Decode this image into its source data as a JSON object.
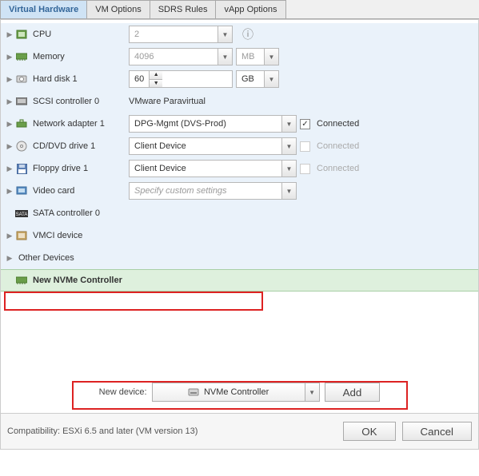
{
  "tabs": {
    "virtual_hardware": "Virtual Hardware",
    "vm_options": "VM Options",
    "sdrs_rules": "SDRS Rules",
    "vapp_options": "vApp Options"
  },
  "rows": {
    "cpu": {
      "label": "CPU",
      "value": "2"
    },
    "memory": {
      "label": "Memory",
      "value": "4096",
      "unit": "MB"
    },
    "hard_disk_1": {
      "label": "Hard disk 1",
      "value": "60",
      "unit": "GB"
    },
    "scsi_0": {
      "label": "SCSI controller 0",
      "value": "VMware Paravirtual"
    },
    "net_1": {
      "label": "Network adapter 1",
      "value": "DPG-Mgmt (DVS-Prod)",
      "connected_label": "Connected"
    },
    "cd_dvd_1": {
      "label": "CD/DVD drive 1",
      "value": "Client Device",
      "connected_label": "Connected"
    },
    "floppy_1": {
      "label": "Floppy drive 1",
      "value": "Client Device",
      "connected_label": "Connected"
    },
    "video": {
      "label": "Video card",
      "value": "Specify custom settings"
    },
    "sata_0": {
      "label": "SATA controller 0"
    },
    "vmci": {
      "label": "VMCI device"
    },
    "other": {
      "label": "Other Devices"
    },
    "new_nvme": {
      "label": "New NVMe Controller"
    }
  },
  "new_device": {
    "label": "New device:",
    "value": "NVMe Controller",
    "add": "Add"
  },
  "footer": {
    "compat": "Compatibility: ESXi 6.5 and later (VM version 13)",
    "ok": "OK",
    "cancel": "Cancel"
  }
}
